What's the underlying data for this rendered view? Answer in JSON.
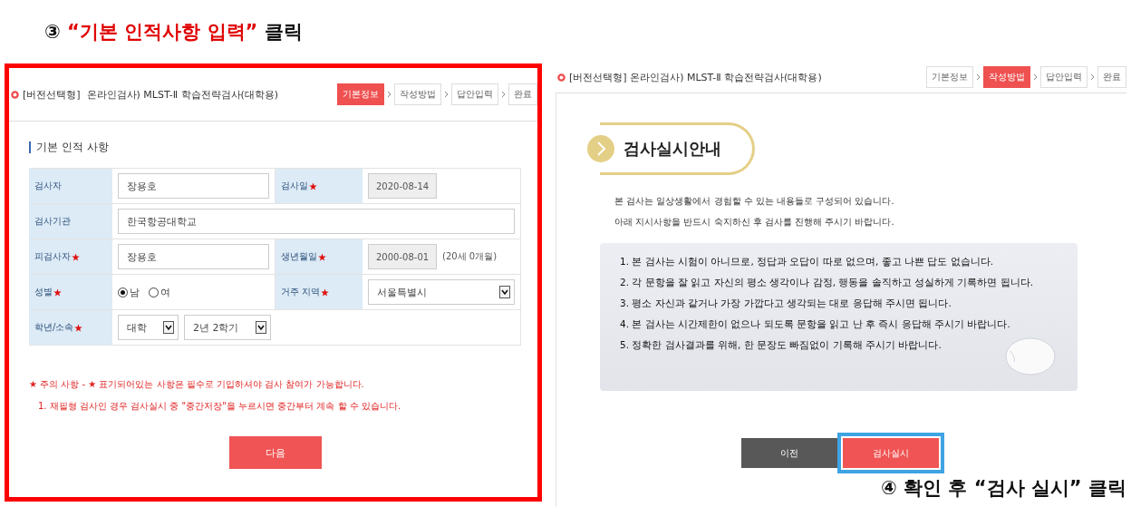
{
  "step3_caption": {
    "number": "③",
    "quote": "“기본 인적사항 입력”",
    "action": "클릭"
  },
  "left_screen": {
    "title": "[버전선택형]  온라인검사) MLST-Ⅱ 학습전략검사(대학용)",
    "steps": [
      {
        "label": "기본정보",
        "selected": true
      },
      {
        "label": "작성방법",
        "selected": false
      },
      {
        "label": "답안입력",
        "selected": false
      },
      {
        "label": "완료",
        "selected": false
      }
    ],
    "section_title": "기본 인적 사항",
    "form_rows": [
      {
        "cells": [
          {
            "label": "검사자",
            "required": false,
            "fields": [
              {
                "kind": "text",
                "value": "장용호"
              }
            ]
          },
          {
            "label": "검사일",
            "required": true,
            "fields": [
              {
                "kind": "readonly",
                "value": "2020-08-14"
              }
            ]
          }
        ]
      },
      {
        "cells": [
          {
            "label": "검사기관",
            "required": false,
            "fields": [
              {
                "kind": "text",
                "value": "한국항공대학교"
              }
            ]
          }
        ]
      },
      {
        "cells": [
          {
            "label": "피검사자",
            "required": true,
            "fields": [
              {
                "kind": "text",
                "value": "장용호"
              }
            ]
          },
          {
            "label": "생년월일",
            "required": true,
            "fields": [
              {
                "kind": "readonly",
                "value": "2000-08-01",
                "note": "(20세 0개월)"
              }
            ]
          }
        ]
      },
      {
        "cells": [
          {
            "label": "성별",
            "required": true,
            "fields": [
              {
                "kind": "radio",
                "options": [
                  {
                    "label": "남",
                    "selected": true
                  },
                  {
                    "label": "여",
                    "selected": false
                  }
                ]
              }
            ]
          },
          {
            "label": "거주 지역",
            "required": true,
            "fields": [
              {
                "kind": "select",
                "value": "서울특별시"
              }
            ]
          }
        ]
      },
      {
        "cells": [
          {
            "label": "학년/소속",
            "required": true,
            "fields": [
              {
                "kind": "select",
                "value": "대학"
              },
              {
                "kind": "select",
                "value": "2년 2학기"
              }
            ]
          }
        ]
      }
    ],
    "notes": [
      {
        "kind": "main",
        "text": "★ 주의 사항 - ★ 표기되어있는 사항은 필수로 기입하셔야 검사 참여가 가능합니다."
      },
      {
        "kind": "sub",
        "text": "1. 재필형 검사인 경우 검사실시 중 \"중간저장\"을 누르시면 중간부터 계속 할 수 있습니다."
      }
    ],
    "next_button": "다음"
  },
  "right_screen": {
    "title": "[버전선택형] 온라인검사) MLST-Ⅱ 학습전략검사(대학용)",
    "steps": [
      {
        "label": "기본정보",
        "selected": false
      },
      {
        "label": "작성방법",
        "selected": true
      },
      {
        "label": "답안입력",
        "selected": false
      },
      {
        "label": "완료",
        "selected": false
      }
    ],
    "heading": "검사실시안내",
    "intro": [
      "본 검사는 일상생활에서 경험할 수 있는 내용들로 구성되어 있습니다.",
      "아래 지시사항을 반드시 숙지하신 후 검사를 진행해 주시기 바랍니다."
    ],
    "instructions": [
      "1. 본 검사는 시험이 아니므로, 정답과 오답이 따로 없으며, 좋고 나쁜 답도 없습니다.",
      "2. 각 문항을 잘 읽고 자신의 평소 생각이나 감정, 행동을 솔직하고 성실하게 기록하면 됩니다.",
      "3. 평소 자신과 같거나 가장 가깝다고 생각되는 대로 응답해 주시면 됩니다.",
      "4. 본 검사는 시간제한이 없으나 되도록 문항을 읽고 난 후 즉시 응답해 주시기 바랍니다.",
      "5. 정확한 검사결과를 위해, 한 문장도 빠짐없이 기록해 주시기 바랍니다."
    ],
    "buttons": [
      {
        "label": "이전",
        "kind": "secondary",
        "highlighted": false
      },
      {
        "label": "검사실시",
        "kind": "primary",
        "highlighted": true
      }
    ]
  },
  "step4_caption": "④ 확인 후 “검사 실시” 클릭"
}
